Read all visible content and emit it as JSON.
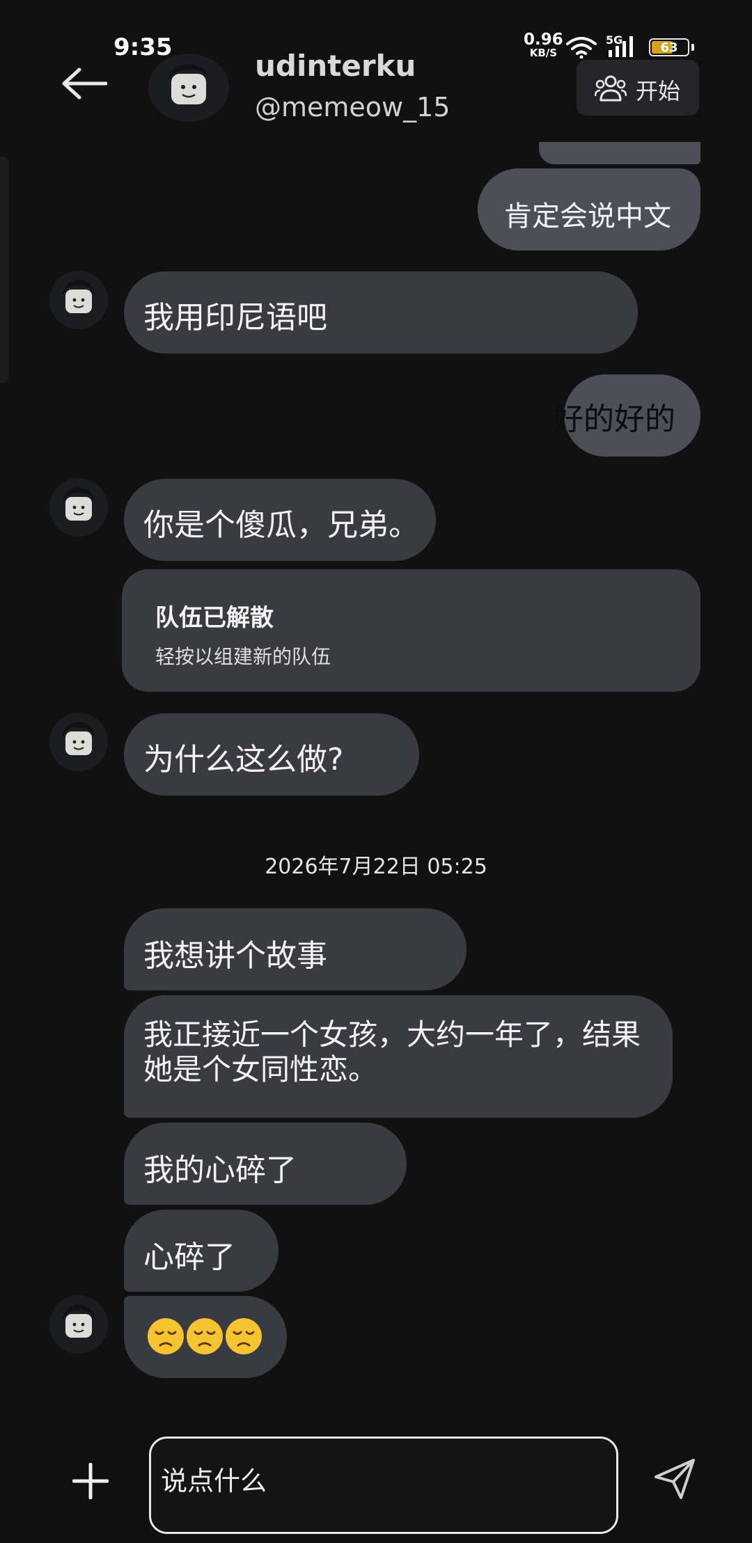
{
  "status": {
    "time": "9:35",
    "net_speed": "0.96",
    "net_unit": "KB/S",
    "network_type": "5G",
    "battery": "63",
    "battery_level": 0.63
  },
  "header": {
    "name": "udinterku",
    "handle": "@memeow_15",
    "start_label": "开始",
    "icons": [
      "back-arrow-icon",
      "group-icon"
    ]
  },
  "messages": [
    {
      "side": "right",
      "text": "肯定会说中文"
    },
    {
      "side": "left",
      "text": "我用印尼语吧"
    },
    {
      "side": "right",
      "text": "好的好的"
    },
    {
      "side": "left",
      "text": "你是个傻瓜，兄弟。"
    },
    {
      "side": "system",
      "title": "队伍已解散",
      "subtitle": "轻按以组建新的队伍"
    },
    {
      "side": "left",
      "text": "为什么这么做?"
    }
  ],
  "timestamp": "2026年7月22日 05:25",
  "group_messages": [
    {
      "text": "我想讲个故事"
    },
    {
      "text": "我正接近一个女孩，大约一年了，结果她是个女同性恋。"
    },
    {
      "text": "我的心碎了"
    },
    {
      "text": "心碎了"
    },
    {
      "emoji": [
        "😞",
        "😞",
        "😞"
      ]
    }
  ],
  "composer": {
    "placeholder": "说点什么",
    "icons": [
      "plus-icon",
      "send-icon"
    ]
  },
  "colors": {
    "background": "#111112",
    "bubble_left": "#3a3b42",
    "bubble_right": "#4d4f58",
    "battery_fill": "#d3a418"
  }
}
